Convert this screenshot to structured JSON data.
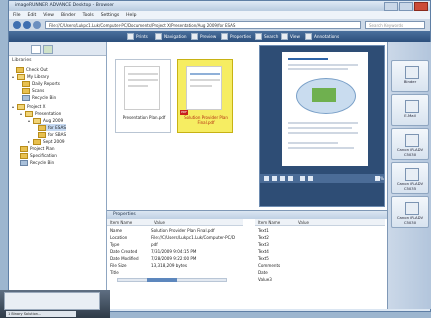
{
  "window": {
    "title": "imageRUNNER ADVANCE Desktop - Browser"
  },
  "menu": [
    "File",
    "Edit",
    "View",
    "Binder",
    "Tools",
    "Settings",
    "Help"
  ],
  "address": {
    "path": "File://C/Users/Lukpc1.Luk/Computer-PC/Documents/Project X/Presentation/Aug 2009/for ESAS",
    "search_placeholder": "Search Keywords"
  },
  "toolbar": [
    "Prints",
    "Navigation",
    "Preview",
    "Properties",
    "Search",
    "View",
    "Annotations"
  ],
  "library": {
    "label": "Libraries",
    "items": [
      "Check Out",
      "My Library",
      "Daily Reports",
      "Scans",
      "Recycle Bin",
      "Project X",
      "Presentation",
      "Aug 2009",
      "for ESAS",
      "for SBAS",
      "Sept 2009",
      "Project Plan",
      "Specification",
      "Recycle Bin"
    ]
  },
  "thumbnails": [
    {
      "caption": "Presentation Plan.pdf"
    },
    {
      "caption": "Solution Provider Plan Final.pdf"
    }
  ],
  "preview": {
    "zoom": "73%"
  },
  "properties": {
    "title": "Properties",
    "col_name": "Item Name",
    "col_value": "Value",
    "rows": [
      {
        "name": "Name",
        "value": "Solution Provider Plan Final.pdf"
      },
      {
        "name": "Location",
        "value": "File://C/Users/Lukpc1.Luk/Computer-PC/D"
      },
      {
        "name": "Type",
        "value": "pdf"
      },
      {
        "name": "Date Created",
        "value": "7/31/2009 9:04:15 PM"
      },
      {
        "name": "Date Modified",
        "value": "7/28/2009 9:22:00 PM"
      },
      {
        "name": "File Size",
        "value": "13,318,209 bytes"
      },
      {
        "name": "Title",
        "value": ""
      }
    ],
    "col_name2": "Item Name",
    "col_value2": "Value",
    "rows2": [
      "Text1",
      "Text2",
      "Text3",
      "Text4",
      "Text5",
      "Comments",
      "Date",
      "Value3"
    ]
  },
  "sidebar": [
    "Binder",
    "E-Mail",
    "Canon iR-ADV C5030",
    "Canon iR-ADV C5035",
    "Canon iR-ADV C5030"
  ],
  "taskbar": {
    "label": "1 Binary Solution..."
  }
}
